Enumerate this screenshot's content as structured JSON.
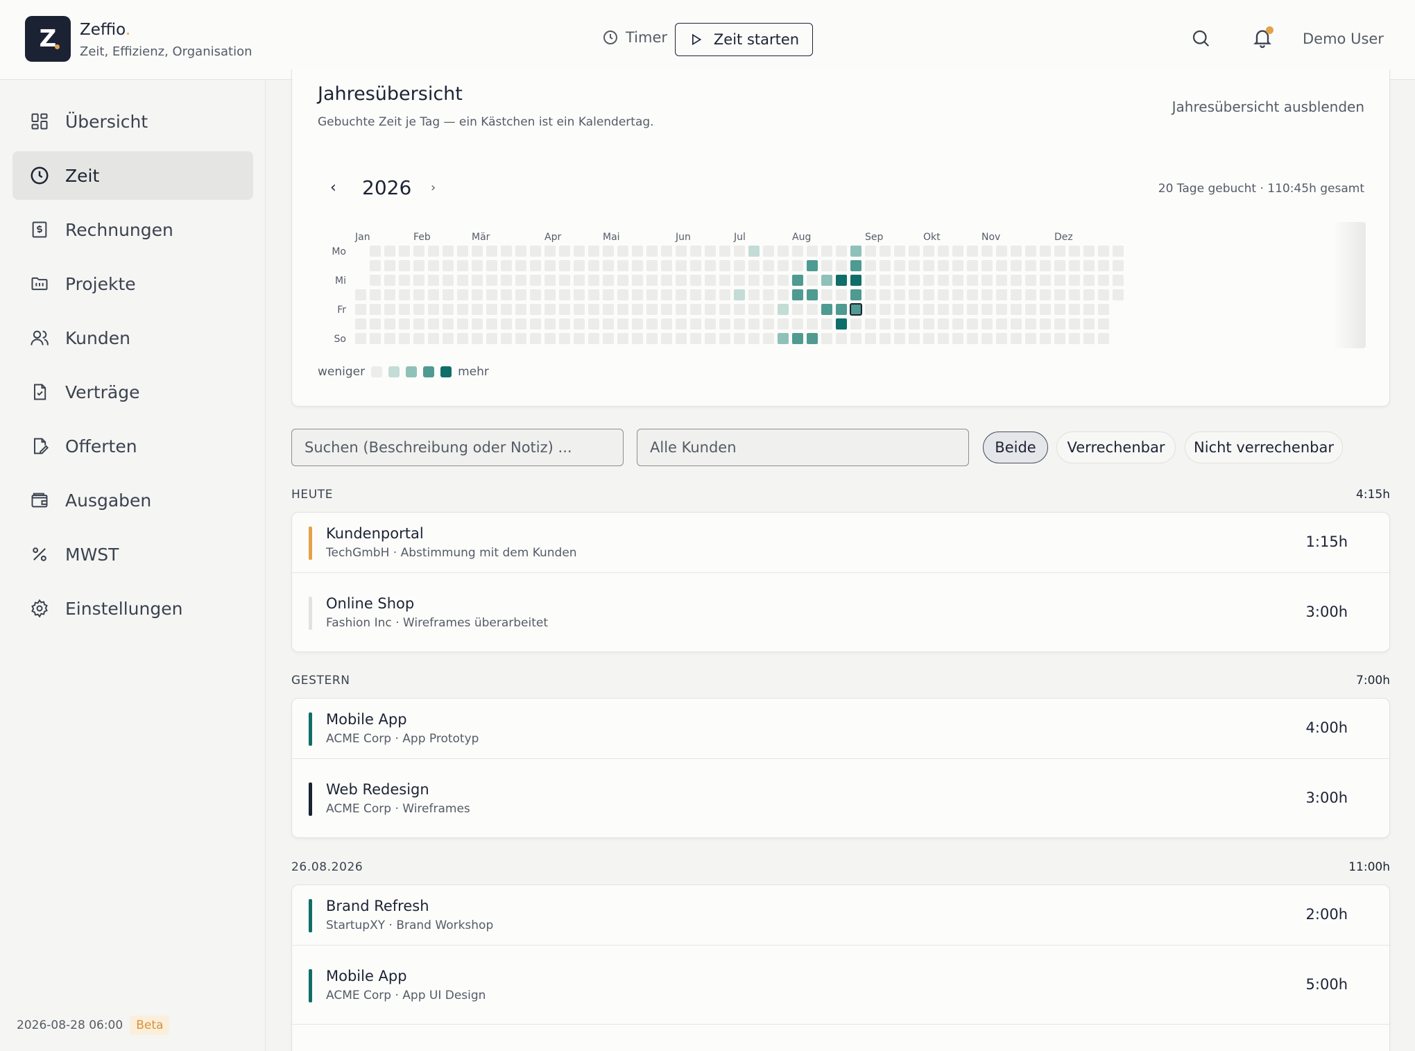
{
  "brand": {
    "initial": "Z",
    "name": "Zeffio",
    "tagline": "Zeit, Effizienz, Organisation",
    "accent": "#e3a24a",
    "dark": "#1b2233"
  },
  "header": {
    "timer_label": "Timer",
    "start_label": "Zeit starten",
    "user_name": "Demo User"
  },
  "sidebar": {
    "items": [
      {
        "label": "Übersicht",
        "icon": "dashboard-icon"
      },
      {
        "label": "Zeit",
        "icon": "clock-icon",
        "active": true
      },
      {
        "label": "Rechnungen",
        "icon": "invoice-icon"
      },
      {
        "label": "Projekte",
        "icon": "folder-icon"
      },
      {
        "label": "Kunden",
        "icon": "users-icon"
      },
      {
        "label": "Verträge",
        "icon": "contract-icon"
      },
      {
        "label": "Offerten",
        "icon": "quote-icon"
      },
      {
        "label": "Ausgaben",
        "icon": "wallet-icon"
      },
      {
        "label": "MWST",
        "icon": "percent-icon"
      },
      {
        "label": "Einstellungen",
        "icon": "gear-icon"
      }
    ],
    "timestamp": "2026-08-28 06:00",
    "badge": "Beta"
  },
  "year_overview": {
    "title": "Jahresübersicht",
    "subtitle": "Gebuchte Zeit je Tag — ein Kästchen ist ein Kalendertag.",
    "hide_label": "Jahresübersicht ausblenden",
    "year": "2026",
    "prev": "‹",
    "next": "›",
    "summary": "20 Tage gebucht · 110:45h gesamt",
    "months": [
      "Jan",
      "Feb",
      "Mär",
      "Apr",
      "Mai",
      "Jun",
      "Jul",
      "Aug",
      "Sep",
      "Okt",
      "Nov",
      "Dez"
    ],
    "day_labels": [
      "Mo",
      "",
      "Mi",
      "",
      "Fr",
      "",
      "So"
    ],
    "legend_less": "weniger",
    "legend_more": "mehr",
    "levels": [
      "#ececea",
      "#c3dcd6",
      "#8fc1b9",
      "#4f9a91",
      "#0f6e68"
    ],
    "filled_days": [
      {
        "week": 27,
        "day": 0,
        "level": 1
      },
      {
        "week": 26,
        "day": 3,
        "level": 1
      },
      {
        "week": 29,
        "day": 4,
        "level": 1
      },
      {
        "week": 29,
        "day": 6,
        "level": 2
      },
      {
        "week": 30,
        "day": 2,
        "level": 3
      },
      {
        "week": 30,
        "day": 6,
        "level": 3
      },
      {
        "week": 31,
        "day": 1,
        "level": 3
      },
      {
        "week": 30,
        "day": 3,
        "level": 3
      },
      {
        "week": 31,
        "day": 3,
        "level": 3
      },
      {
        "week": 31,
        "day": 6,
        "level": 3
      },
      {
        "week": 32,
        "day": 2,
        "level": 2
      },
      {
        "week": 32,
        "day": 4,
        "level": 3
      },
      {
        "week": 33,
        "day": 2,
        "level": 4
      },
      {
        "week": 33,
        "day": 4,
        "level": 3
      },
      {
        "week": 33,
        "day": 5,
        "level": 4
      },
      {
        "week": 34,
        "day": 0,
        "level": 2
      },
      {
        "week": 34,
        "day": 1,
        "level": 3
      },
      {
        "week": 34,
        "day": 2,
        "level": 4
      },
      {
        "week": 34,
        "day": 3,
        "level": 3
      },
      {
        "week": 34,
        "day": 4,
        "level": 3,
        "today": true
      }
    ]
  },
  "filters": {
    "search_placeholder": "Suchen (Beschreibung oder Notiz) ...",
    "customer_placeholder": "Alle Kunden",
    "billable_options": [
      "Beide",
      "Verrechenbar",
      "Nicht verrechenbar"
    ],
    "billable_selected": "Beide"
  },
  "sections": [
    {
      "label": "HEUTE",
      "total": "4:15h",
      "entries": [
        {
          "title": "Kundenportal",
          "sub": "TechGmbH · Abstimmung mit dem Kunden",
          "duration": "1:15h",
          "color": "#e3a24a"
        },
        {
          "title": "Online Shop",
          "sub": "Fashion Inc · Wireframes überarbeitet",
          "duration": "3:00h",
          "color": "#e2e2de"
        }
      ]
    },
    {
      "label": "GESTERN",
      "total": "7:00h",
      "entries": [
        {
          "title": "Mobile App",
          "sub": "ACME Corp · App Prototyp",
          "duration": "4:00h",
          "color": "#0f6e68"
        },
        {
          "title": "Web Redesign",
          "sub": "ACME Corp · Wireframes",
          "duration": "3:00h",
          "color": "#1b2233"
        }
      ]
    },
    {
      "label": "26.08.2026",
      "total": "11:00h",
      "entries": [
        {
          "title": "Brand Refresh",
          "sub": "StartupXY · Brand Workshop",
          "duration": "2:00h",
          "color": "#0f6e68"
        },
        {
          "title": "Mobile App",
          "sub": "ACME Corp · App UI Design",
          "duration": "5:00h",
          "color": "#0f6e68"
        }
      ]
    }
  ]
}
